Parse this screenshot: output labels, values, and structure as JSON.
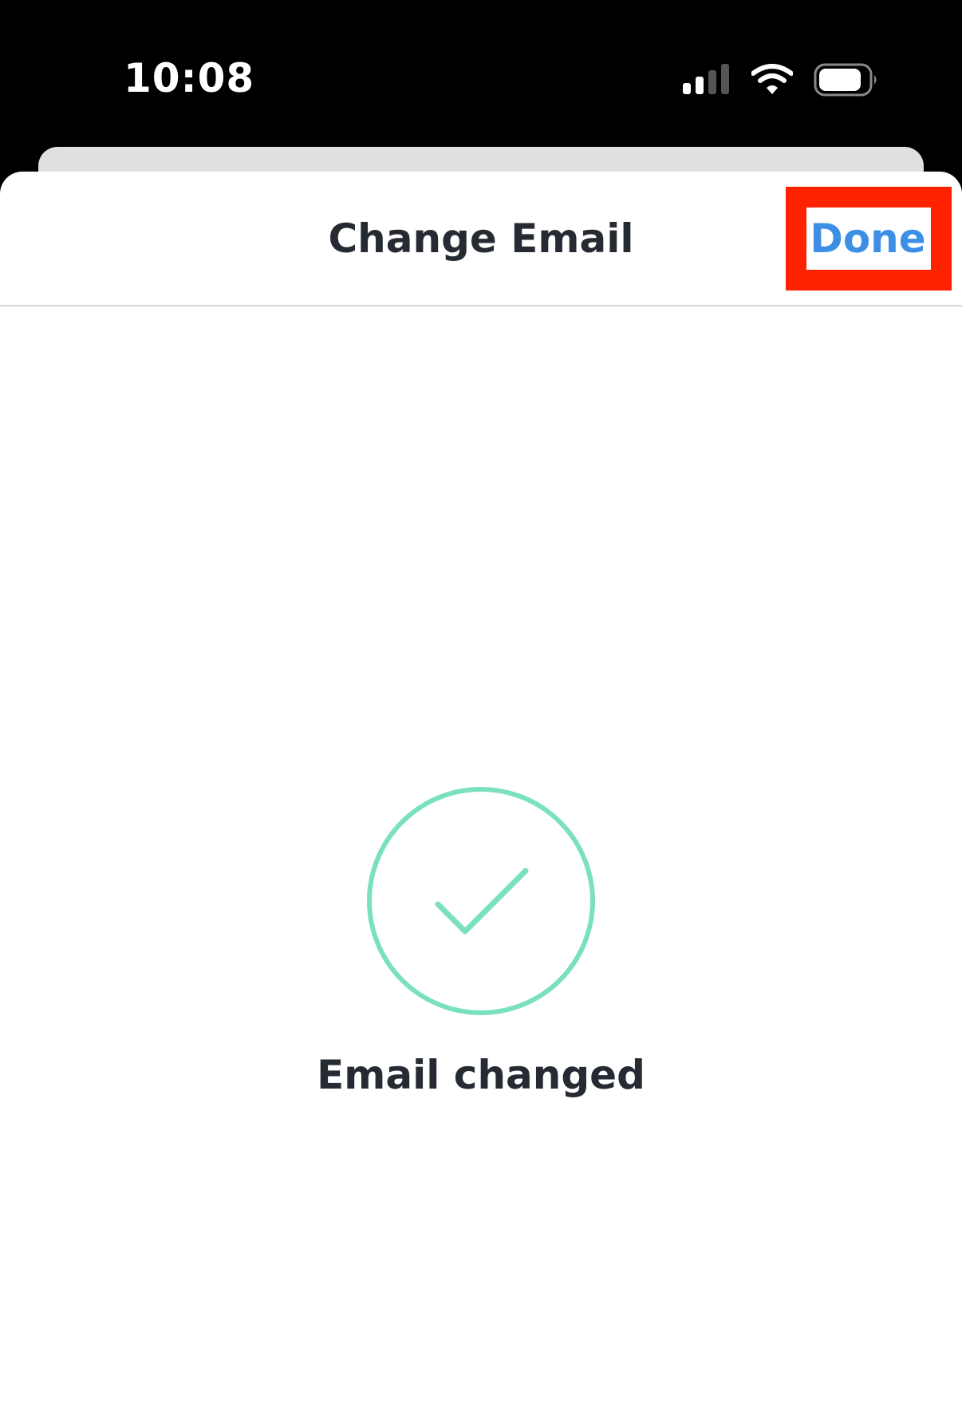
{
  "status_bar": {
    "time": "10:08",
    "icons": [
      "cellular-signal-icon",
      "wifi-icon",
      "battery-icon"
    ]
  },
  "sheet": {
    "title": "Change Email",
    "done_label": "Done"
  },
  "success": {
    "icon": "check-circle-icon",
    "message": "Email changed"
  },
  "colors": {
    "accent": "#3d8fe6",
    "success": "#7ae0c0",
    "highlight": "#ff2200",
    "text": "#262b33"
  }
}
